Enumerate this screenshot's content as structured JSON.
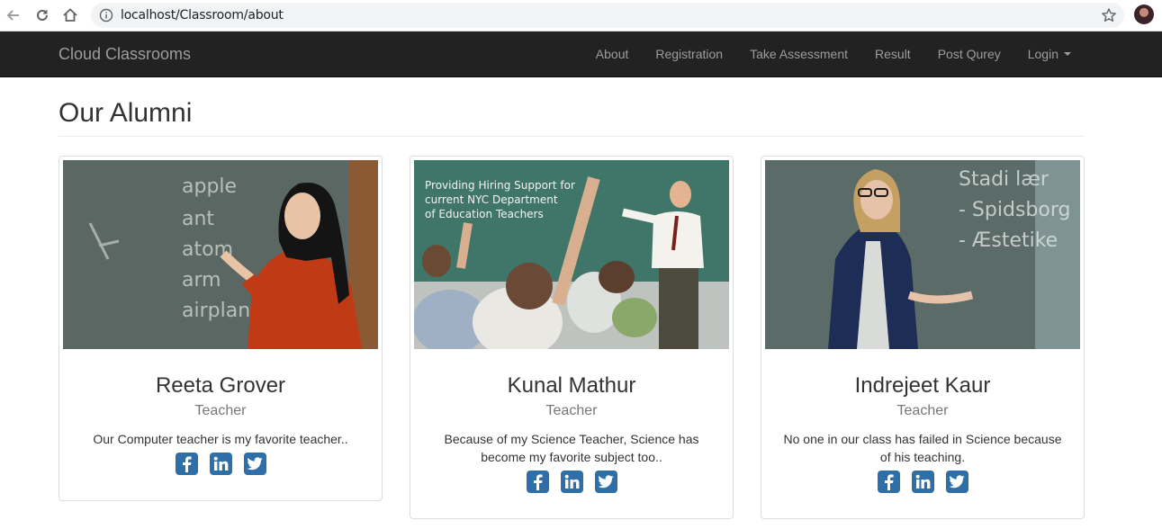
{
  "browser": {
    "url": "localhost/Classroom/about"
  },
  "navbar": {
    "brand": "Cloud Classrooms",
    "items": [
      {
        "label": "About"
      },
      {
        "label": "Registration"
      },
      {
        "label": "Take Assessment"
      },
      {
        "label": "Result"
      },
      {
        "label": "Post Qurey"
      },
      {
        "label": "Login"
      }
    ]
  },
  "page": {
    "title": "Our Alumni"
  },
  "alumni": [
    {
      "name": "Reeta Grover",
      "role": "Teacher",
      "quote": "Our Computer teacher is my favorite teacher..",
      "photo_text": [
        "apple",
        "ant",
        "atom",
        "arm",
        "airplane"
      ]
    },
    {
      "name": "Kunal Mathur",
      "role": "Teacher",
      "quote": "Because of my Science Teacher, Science has become my favorite subject too..",
      "photo_text": [
        "Providing Hiring Support for",
        "current NYC Department",
        "of Education Teachers"
      ]
    },
    {
      "name": "Indrejeet Kaur",
      "role": "Teacher",
      "quote": "No one in our class has failed in Science because of his teaching.",
      "photo_text": [
        "Stadi lær",
        "- Spidsborg",
        "- Æstetike"
      ]
    }
  ],
  "colors": {
    "navbar_bg": "#222222",
    "nav_text": "#9d9d9d",
    "social_blue": "#2f6fa9"
  }
}
